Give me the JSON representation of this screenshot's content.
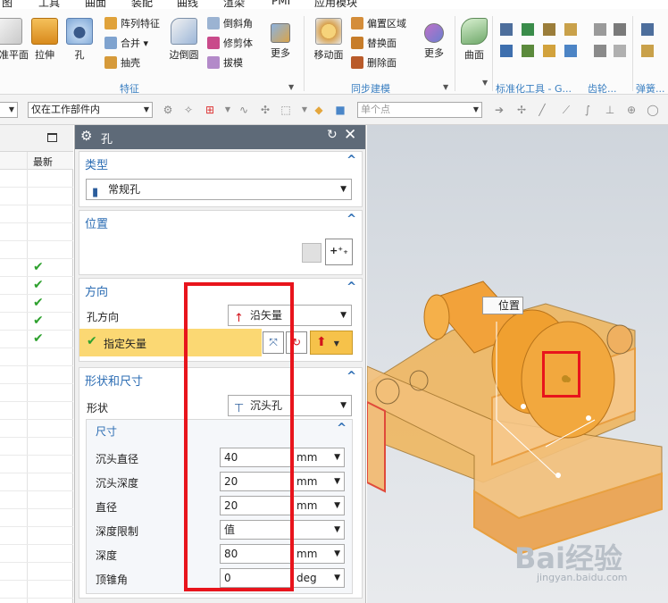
{
  "menu": [
    "图",
    "工具",
    "曲面",
    "装配",
    "曲线",
    "渲染",
    "PMI",
    "应用模块"
  ],
  "ribbon": {
    "big_buttons": [
      {
        "label": "基准平面",
        "icon": "datum-plane-icon"
      },
      {
        "label": "拉伸",
        "icon": "extrude-icon"
      },
      {
        "label": "孔",
        "icon": "hole-icon"
      },
      {
        "label": "边倒圆",
        "icon": "edge-blend-icon"
      },
      {
        "label": "更多",
        "icon": "more-icon"
      },
      {
        "label": "移动面",
        "icon": "move-face-icon"
      },
      {
        "label": "更多",
        "icon": "more-icon"
      },
      {
        "label": "曲面",
        "icon": "surface-icon"
      }
    ],
    "small_buttons": [
      {
        "label": "阵列特征",
        "icon": "pattern-feature-icon"
      },
      {
        "label": "合并",
        "icon": "unite-icon"
      },
      {
        "label": "抽壳",
        "icon": "shell-icon"
      },
      {
        "label": "倒斜角",
        "icon": "chamfer-icon"
      },
      {
        "label": "修剪体",
        "icon": "trim-body-icon"
      },
      {
        "label": "拔模",
        "icon": "draft-icon"
      },
      {
        "label": "偏置区域",
        "icon": "offset-region-icon"
      },
      {
        "label": "替换面",
        "icon": "replace-face-icon"
      },
      {
        "label": "删除面",
        "icon": "delete-face-icon"
      }
    ],
    "groups": [
      "特征",
      "同步建模",
      "标准化工具 - G...",
      "齿轮...",
      "弹簧..."
    ]
  },
  "selection_bar": {
    "filter_value": "仅在工作部件内",
    "snap_placeholder": "单个点"
  },
  "navigator": {
    "column_header": "最新",
    "checked_rows": 5
  },
  "dialog": {
    "title": "孔",
    "type_section": {
      "title": "类型",
      "value": "常规孔"
    },
    "position_section": {
      "title": "位置"
    },
    "direction_section": {
      "title": "方向",
      "hole_direction_label": "孔方向",
      "hole_direction_value": "沿矢量",
      "vector_label": "指定矢量"
    },
    "shape_section": {
      "title": "形状和尺寸",
      "shape_label": "形状",
      "shape_value": "沉头孔",
      "dimensions_title": "尺寸",
      "fields": [
        {
          "label": "沉头直径",
          "value": "40",
          "unit": "mm"
        },
        {
          "label": "沉头深度",
          "value": "20",
          "unit": "mm"
        },
        {
          "label": "直径",
          "value": "20",
          "unit": "mm"
        },
        {
          "label": "深度限制",
          "value": "值",
          "unit": ""
        },
        {
          "label": "深度",
          "value": "80",
          "unit": "mm"
        },
        {
          "label": "顶锥角",
          "value": "0",
          "unit": "deg"
        }
      ]
    }
  },
  "viewport": {
    "position_tag": "位置",
    "watermark": "Bai经验",
    "watermark_url": "jingyan.baidu.com"
  },
  "colors": {
    "dialog_title": "#5e6a78",
    "section_title": "#2b6cb3",
    "highlight_row": "#fbd873",
    "annotation_red": "#e8141c",
    "part_orange": "#f0a830"
  }
}
